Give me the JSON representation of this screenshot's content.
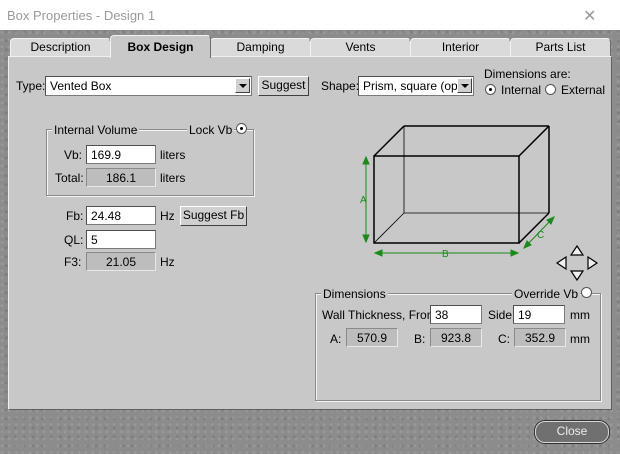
{
  "window": {
    "title": "Box Properties - Design 1",
    "close_glyph": "✕"
  },
  "tabs": [
    "Description",
    "Box Design",
    "Damping",
    "Vents",
    "Interior",
    "Parts List"
  ],
  "active_tab": "Box Design",
  "type": {
    "label": "Type:",
    "value": "Vented Box",
    "suggest_label": "Suggest"
  },
  "shape": {
    "label": "Shape:",
    "value": "Prism, square (opt.)"
  },
  "dimensions_are": {
    "label": "Dimensions are:",
    "options": [
      "Internal",
      "External"
    ],
    "selected": "Internal"
  },
  "internal_volume": {
    "group_label": "Internal Volume",
    "lock_label": "Lock Vb",
    "vb_label": "Vb:",
    "vb_value": "169.9",
    "vb_unit": "liters",
    "total_label": "Total:",
    "total_value": "186.1",
    "total_unit": "liters"
  },
  "tuning": {
    "fb_label": "Fb:",
    "fb_value": "24.48",
    "fb_unit": "Hz",
    "suggest_fb_label": "Suggest Fb",
    "ql_label": "QL:",
    "ql_value": "5",
    "f3_label": "F3:",
    "f3_value": "21.05",
    "f3_unit": "Hz"
  },
  "diagram": {
    "label_a": "A",
    "label_b": "B",
    "label_c": "C",
    "line_color": "#1a8a1a"
  },
  "dimensions": {
    "group_label": "Dimensions",
    "override_label": "Override Vb",
    "wall_front_label": "Wall Thickness, Front:",
    "wall_front_value": "38",
    "side_label": "Side:",
    "side_value": "19",
    "unit": "mm",
    "a_label": "A:",
    "a_value": "570.9",
    "b_label": "B:",
    "b_value": "923.8",
    "c_label": "C:",
    "c_value": "352.9",
    "c_unit": "mm"
  },
  "close_label": "Close"
}
